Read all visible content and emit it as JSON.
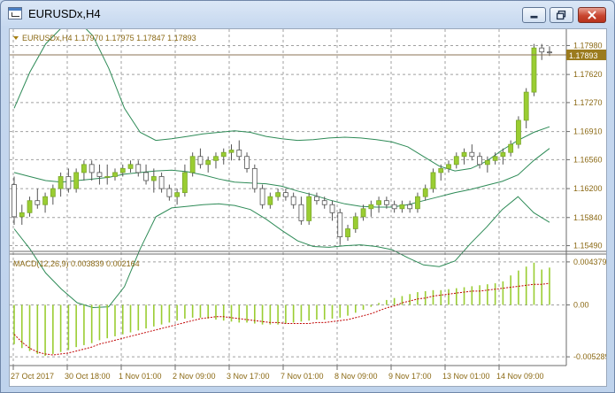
{
  "window": {
    "title": "EURUSDx,H4"
  },
  "chart": {
    "info_label": "EURUSDx,H4  1.17970 1.17975 1.17847 1.17893",
    "current_price": "1.17893",
    "price_ticks": [
      "1.17980",
      "1.17620",
      "1.17270",
      "1.16910",
      "1.16560",
      "1.16200",
      "1.15840",
      "1.15490"
    ],
    "macd_label": "MACD(12,26,9) 0.003839 0.002164",
    "macd_ticks": [
      "0.004379",
      "0.00",
      "-0.005289"
    ],
    "time_ticks": [
      "27 Oct 2017",
      "30 Oct 18:00",
      "1 Nov 01:00",
      "2 Nov 09:00",
      "3 Nov 17:00",
      "7 Nov 01:00",
      "8 Nov 09:00",
      "9 Nov 17:00",
      "13 Nov 01:00",
      "14 Nov 09:00"
    ],
    "colors": {
      "bull": "#9acd32",
      "bear": "#ffffff",
      "wick": "#555555",
      "band": "#2e8b57",
      "macd_hist": "#9acd32",
      "macd_signal": "#c00000",
      "axis_text": "#8b6914",
      "grid": "#a0a0a0"
    }
  },
  "chart_data": {
    "type": "candlestick",
    "candles": [
      [
        1.1625,
        1.1635,
        1.1575,
        1.1585
      ],
      [
        1.1585,
        1.16,
        1.1575,
        1.159
      ],
      [
        1.159,
        1.161,
        1.1585,
        1.1605
      ],
      [
        1.1605,
        1.162,
        1.1595,
        1.16
      ],
      [
        1.16,
        1.1615,
        1.159,
        1.161
      ],
      [
        1.161,
        1.1625,
        1.16,
        1.162
      ],
      [
        1.162,
        1.164,
        1.161,
        1.1635
      ],
      [
        1.1635,
        1.1645,
        1.1615,
        1.162
      ],
      [
        1.162,
        1.1645,
        1.1615,
        1.164
      ],
      [
        1.164,
        1.1655,
        1.163,
        1.165
      ],
      [
        1.165,
        1.1655,
        1.163,
        1.164
      ],
      [
        1.164,
        1.165,
        1.1625,
        1.1635
      ],
      [
        1.1635,
        1.165,
        1.1625,
        1.1635
      ],
      [
        1.1635,
        1.1645,
        1.163,
        1.164
      ],
      [
        1.164,
        1.165,
        1.1635,
        1.1645
      ],
      [
        1.1645,
        1.1655,
        1.164,
        1.165
      ],
      [
        1.165,
        1.1655,
        1.1635,
        1.164
      ],
      [
        1.164,
        1.165,
        1.1625,
        1.163
      ],
      [
        1.163,
        1.1645,
        1.1615,
        1.1635
      ],
      [
        1.1635,
        1.164,
        1.1615,
        1.162
      ],
      [
        1.162,
        1.1625,
        1.1605,
        1.161
      ],
      [
        1.161,
        1.162,
        1.16,
        1.1615
      ],
      [
        1.1615,
        1.165,
        1.161,
        1.164
      ],
      [
        1.164,
        1.1665,
        1.1635,
        1.166
      ],
      [
        1.166,
        1.167,
        1.1645,
        1.165
      ],
      [
        1.165,
        1.166,
        1.164,
        1.1655
      ],
      [
        1.1655,
        1.1665,
        1.1645,
        1.166
      ],
      [
        1.166,
        1.167,
        1.165,
        1.1665
      ],
      [
        1.1665,
        1.1675,
        1.1655,
        1.1668
      ],
      [
        1.1668,
        1.168,
        1.1655,
        1.166
      ],
      [
        1.166,
        1.1665,
        1.164,
        1.1645
      ],
      [
        1.1645,
        1.165,
        1.1615,
        1.162
      ],
      [
        1.162,
        1.1625,
        1.1595,
        1.16
      ],
      [
        1.16,
        1.1615,
        1.1595,
        1.161
      ],
      [
        1.161,
        1.162,
        1.1605,
        1.1615
      ],
      [
        1.1615,
        1.162,
        1.1605,
        1.161
      ],
      [
        1.161,
        1.1615,
        1.1595,
        1.16
      ],
      [
        1.16,
        1.161,
        1.1575,
        1.158
      ],
      [
        1.158,
        1.1615,
        1.1575,
        1.161
      ],
      [
        1.161,
        1.1615,
        1.16,
        1.1605
      ],
      [
        1.1605,
        1.161,
        1.1595,
        1.16
      ],
      [
        1.16,
        1.1605,
        1.158,
        1.159
      ],
      [
        1.159,
        1.1595,
        1.155,
        1.156
      ],
      [
        1.156,
        1.1575,
        1.1555,
        1.157
      ],
      [
        1.157,
        1.159,
        1.1565,
        1.1585
      ],
      [
        1.1585,
        1.16,
        1.158,
        1.1595
      ],
      [
        1.1595,
        1.1605,
        1.1585,
        1.16
      ],
      [
        1.16,
        1.161,
        1.159,
        1.1605
      ],
      [
        1.1605,
        1.161,
        1.1595,
        1.16
      ],
      [
        1.16,
        1.1605,
        1.159,
        1.1595
      ],
      [
        1.1595,
        1.1605,
        1.159,
        1.16
      ],
      [
        1.16,
        1.1605,
        1.159,
        1.1595
      ],
      [
        1.1595,
        1.1615,
        1.159,
        1.161
      ],
      [
        1.161,
        1.1625,
        1.1605,
        1.162
      ],
      [
        1.162,
        1.1645,
        1.1615,
        1.164
      ],
      [
        1.164,
        1.165,
        1.163,
        1.1645
      ],
      [
        1.1645,
        1.1655,
        1.164,
        1.165
      ],
      [
        1.165,
        1.1665,
        1.1645,
        1.166
      ],
      [
        1.166,
        1.167,
        1.165,
        1.1665
      ],
      [
        1.1665,
        1.1675,
        1.1655,
        1.166
      ],
      [
        1.166,
        1.1665,
        1.1645,
        1.165
      ],
      [
        1.165,
        1.166,
        1.164,
        1.1655
      ],
      [
        1.1655,
        1.1665,
        1.165,
        1.166
      ],
      [
        1.166,
        1.167,
        1.165,
        1.1665
      ],
      [
        1.1665,
        1.168,
        1.166,
        1.1675
      ],
      [
        1.1675,
        1.171,
        1.167,
        1.1705
      ],
      [
        1.1705,
        1.1745,
        1.1695,
        1.174
      ],
      [
        1.174,
        1.18,
        1.1735,
        1.1795
      ],
      [
        1.1795,
        1.18,
        1.178,
        1.179
      ],
      [
        1.179,
        1.1797,
        1.1785,
        1.1789
      ]
    ],
    "bb_upper": [
      1.172,
      1.1765,
      1.18,
      1.182,
      1.183,
      1.181,
      1.177,
      1.172,
      1.169,
      1.168,
      1.1682,
      1.1685,
      1.1688,
      1.169,
      1.1692,
      1.169,
      1.1685,
      1.1682,
      1.168,
      1.1681,
      1.1683,
      1.1684,
      1.1683,
      1.1681,
      1.1678,
      1.1672,
      1.166,
      1.1648,
      1.1642,
      1.1645,
      1.1654,
      1.1668,
      1.168,
      1.169,
      1.1697
    ],
    "bb_middle": [
      1.164,
      1.1635,
      1.163,
      1.1628,
      1.163,
      1.1632,
      1.1634,
      1.1638,
      1.164,
      1.1642,
      1.1643,
      1.1641,
      1.1637,
      1.1632,
      1.1628,
      1.1627,
      1.1626,
      1.1623,
      1.1617,
      1.1612,
      1.1606,
      1.1601,
      1.1598,
      1.1597,
      1.1597,
      1.16,
      1.1605,
      1.161,
      1.1615,
      1.1619,
      1.1624,
      1.1629,
      1.1637,
      1.1655,
      1.167
    ],
    "bb_lower": [
      1.157,
      1.1545,
      1.1515,
      1.1495,
      1.1478,
      1.1472,
      1.1473,
      1.1498,
      1.1545,
      1.1585,
      1.1596,
      1.1598,
      1.16,
      1.1601,
      1.1599,
      1.1594,
      1.1582,
      1.1568,
      1.1555,
      1.1548,
      1.1547,
      1.1549,
      1.155,
      1.1548,
      1.1544,
      1.1534,
      1.1525,
      1.1523,
      1.153,
      1.1552,
      1.1572,
      1.1594,
      1.161,
      1.159,
      1.1578
    ],
    "macd_hist": [
      -0.004,
      -0.0044,
      -0.0047,
      -0.005,
      -0.0052,
      -0.005,
      -0.0048,
      -0.0046,
      -0.0043,
      -0.0041,
      -0.0039,
      -0.0036,
      -0.0034,
      -0.0032,
      -0.003,
      -0.0028,
      -0.0026,
      -0.0024,
      -0.0022,
      -0.002,
      -0.0018,
      -0.0016,
      -0.0014,
      -0.0013,
      -0.0013,
      -0.0014,
      -0.0015,
      -0.0016,
      -0.0017,
      -0.0018,
      -0.0018,
      -0.0019,
      -0.002,
      -0.002,
      -0.002,
      -0.0019,
      -0.0018,
      -0.0017,
      -0.0016,
      -0.0015,
      -0.0015,
      -0.0014,
      -0.0013,
      -0.0011,
      -0.0008,
      -0.0005,
      -0.0002,
      0.0002,
      0.0005,
      0.0007,
      0.0009,
      0.0011,
      0.0013,
      0.0014,
      0.0015,
      0.0015,
      0.0016,
      0.0017,
      0.0018,
      0.0019,
      0.002,
      0.0021,
      0.0022,
      0.0024,
      0.003,
      0.0035,
      0.0039,
      0.0043,
      0.0036,
      0.0038
    ],
    "macd_signal": [
      -0.003,
      -0.0038,
      -0.0044,
      -0.0048,
      -0.005,
      -0.0051,
      -0.005,
      -0.0049,
      -0.0047,
      -0.0045,
      -0.0043,
      -0.004,
      -0.0038,
      -0.0036,
      -0.0034,
      -0.0032,
      -0.003,
      -0.0028,
      -0.0026,
      -0.0024,
      -0.0022,
      -0.002,
      -0.0018,
      -0.0016,
      -0.0014,
      -0.0013,
      -0.0012,
      -0.0012,
      -0.0013,
      -0.0014,
      -0.0015,
      -0.0016,
      -0.0017,
      -0.0018,
      -0.0018,
      -0.0019,
      -0.0019,
      -0.0019,
      -0.0019,
      -0.0018,
      -0.0018,
      -0.0017,
      -0.0016,
      -0.0015,
      -0.0013,
      -0.0011,
      -0.0009,
      -0.0006,
      -0.0003,
      -0.0001,
      0.0002,
      0.0004,
      0.0006,
      0.0007,
      0.0009,
      0.001,
      0.0011,
      0.0012,
      0.0013,
      0.0014,
      0.0014,
      0.0015,
      0.0016,
      0.0017,
      0.0018,
      0.0019,
      0.002,
      0.0021,
      0.0021,
      0.0022
    ]
  }
}
